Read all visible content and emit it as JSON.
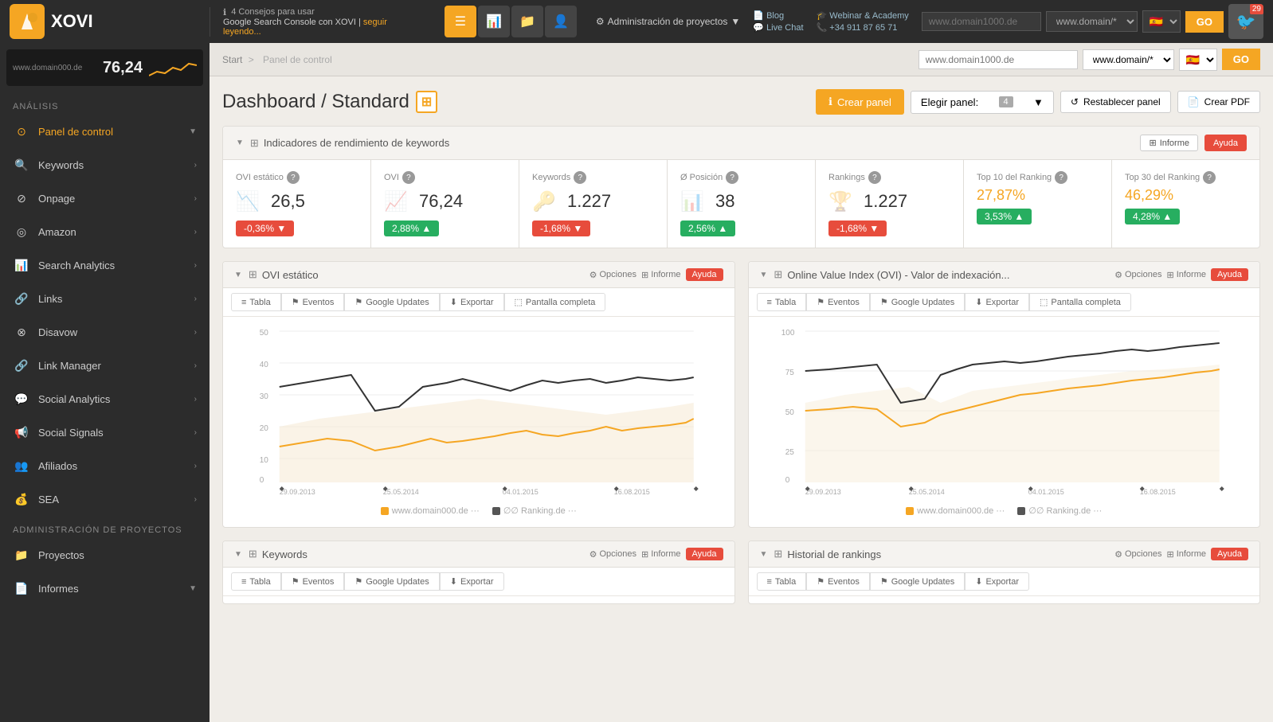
{
  "topBar": {
    "logo": "XOVI",
    "tip": {
      "icon": "ℹ",
      "title": "4 Consejos para usar",
      "subtitle": "Google Search Console con XOVI |",
      "link": "seguir leyendo..."
    },
    "projectBtn": "Administración de proyectos",
    "links": [
      {
        "label": "Blog",
        "icon": "📄"
      },
      {
        "label": "Live Chat",
        "icon": "💬"
      },
      {
        "label": "Webinar & Academy",
        "icon": "🎓"
      },
      {
        "label": "+34 911 87 65 71",
        "icon": "📞"
      }
    ],
    "search": {
      "placeholder": "www.domain1000.de",
      "domain": "www.domain/*",
      "flag": "🇪🇸",
      "goLabel": "GO"
    },
    "user": {
      "badge": "29"
    }
  },
  "breadcrumb": {
    "start": "Start",
    "separator": ">",
    "current": "Panel de control"
  },
  "page": {
    "title": "Dashboard / Standard",
    "createBtn": "Crear panel",
    "choosePanelLabel": "Elegir panel:",
    "choosePanelCount": "4",
    "restoreBtn": "Restablecer panel",
    "pdfBtn": "Crear PDF"
  },
  "kpiSection": {
    "collapseArrow": "▼",
    "title": "Indicadores de rendimiento de keywords",
    "reportBtn": "Informe",
    "helpBtn": "Ayuda",
    "cards": [
      {
        "label": "OVI estático",
        "value": "26,5",
        "badgeText": "-0,36% ▼",
        "badgeType": "red",
        "icon": "📉"
      },
      {
        "label": "OVI",
        "value": "76,24",
        "badgeText": "2,88% ▲",
        "badgeType": "green",
        "icon": "📈"
      },
      {
        "label": "Keywords",
        "value": "1.227",
        "badgeText": "-1,68% ▼",
        "badgeType": "red",
        "icon": "🔑"
      },
      {
        "label": "Ø Posición",
        "value": "38",
        "badgeText": "2,56% ▲",
        "badgeType": "green",
        "icon": "📊"
      },
      {
        "label": "Rankings",
        "value": "1.227",
        "badgeText": "-1,68% ▼",
        "badgeType": "red",
        "icon": "🏆"
      },
      {
        "label": "Top 10 del Ranking",
        "value": "27,87%",
        "badgeText": "3,53% ▲",
        "badgeType": "green",
        "icon": "🥇"
      },
      {
        "label": "Top 30 del Ranking",
        "value": "46,29%",
        "badgeText": "4,28% ▲",
        "badgeType": "green",
        "icon": "🥉"
      }
    ]
  },
  "charts": [
    {
      "title": "OVI estático",
      "collapseArrow": "▼",
      "optionsBtn": "Opciones",
      "reportBtn": "Informe",
      "helpBtn": "Ayuda",
      "tabs": [
        "Tabla",
        "Eventos",
        "Google Updates",
        "Exportar",
        "Pantalla completa"
      ],
      "yMax": 50,
      "xLabels": [
        "29.09.2013",
        "25.05.2014",
        "04.01.2015",
        "16.08.2015"
      ],
      "legend": [
        "www.domain000.de",
        "∅∅ Ranking.de"
      ],
      "legendColors": [
        "#f5a623",
        "#333"
      ]
    },
    {
      "title": "Online Value Index (OVI) - Valor de indexación...",
      "collapseArrow": "▼",
      "optionsBtn": "Opciones",
      "reportBtn": "Informe",
      "helpBtn": "Ayuda",
      "tabs": [
        "Tabla",
        "Eventos",
        "Google Updates",
        "Exportar",
        "Pantalla completa"
      ],
      "yMax": 100,
      "xLabels": [
        "29.09.2013",
        "25.05.2014",
        "04.01.2015",
        "16.08.2015"
      ],
      "legend": [
        "www.domain000.de",
        "∅∅ Ranking.de"
      ],
      "legendColors": [
        "#f5a623",
        "#333"
      ]
    }
  ],
  "bottomCharts": [
    {
      "title": "Keywords",
      "collapseArrow": "▼",
      "optionsBtn": "Opciones",
      "reportBtn": "Informe",
      "helpBtn": "Ayuda",
      "tabs": [
        "Tabla",
        "Eventos",
        "Google Updates",
        "Exportar"
      ]
    },
    {
      "title": "Historial de rankings",
      "collapseArrow": "▼",
      "optionsBtn": "Opciones",
      "reportBtn": "Informe",
      "helpBtn": "Ayuda",
      "tabs": [
        "Tabla",
        "Eventos",
        "Google Updates",
        "Exportar"
      ]
    }
  ],
  "sidebar": {
    "analisisLabel": "ANÁLISIS",
    "adminLabel": "ADMINISTRACIÓN DE PROYECTOS",
    "scoreNum": "76,24",
    "items": [
      {
        "label": "Panel de control",
        "icon": "⊙",
        "active": true
      },
      {
        "label": "Keywords",
        "icon": "🔍"
      },
      {
        "label": "Onpage",
        "icon": "⊘"
      },
      {
        "label": "Amazon",
        "icon": "◎"
      },
      {
        "label": "Search Analytics",
        "icon": "📊"
      },
      {
        "label": "Links",
        "icon": "🔗"
      },
      {
        "label": "Disavow",
        "icon": "⊗"
      },
      {
        "label": "Link Manager",
        "icon": "🔗"
      },
      {
        "label": "Social Analytics",
        "icon": "💬"
      },
      {
        "label": "Social Signals",
        "icon": "📢"
      },
      {
        "label": "Afiliados",
        "icon": "👥"
      },
      {
        "label": "SEA",
        "icon": "💰"
      },
      {
        "label": "Proyectos",
        "icon": "📁"
      },
      {
        "label": "Informes",
        "icon": "📄"
      }
    ]
  }
}
